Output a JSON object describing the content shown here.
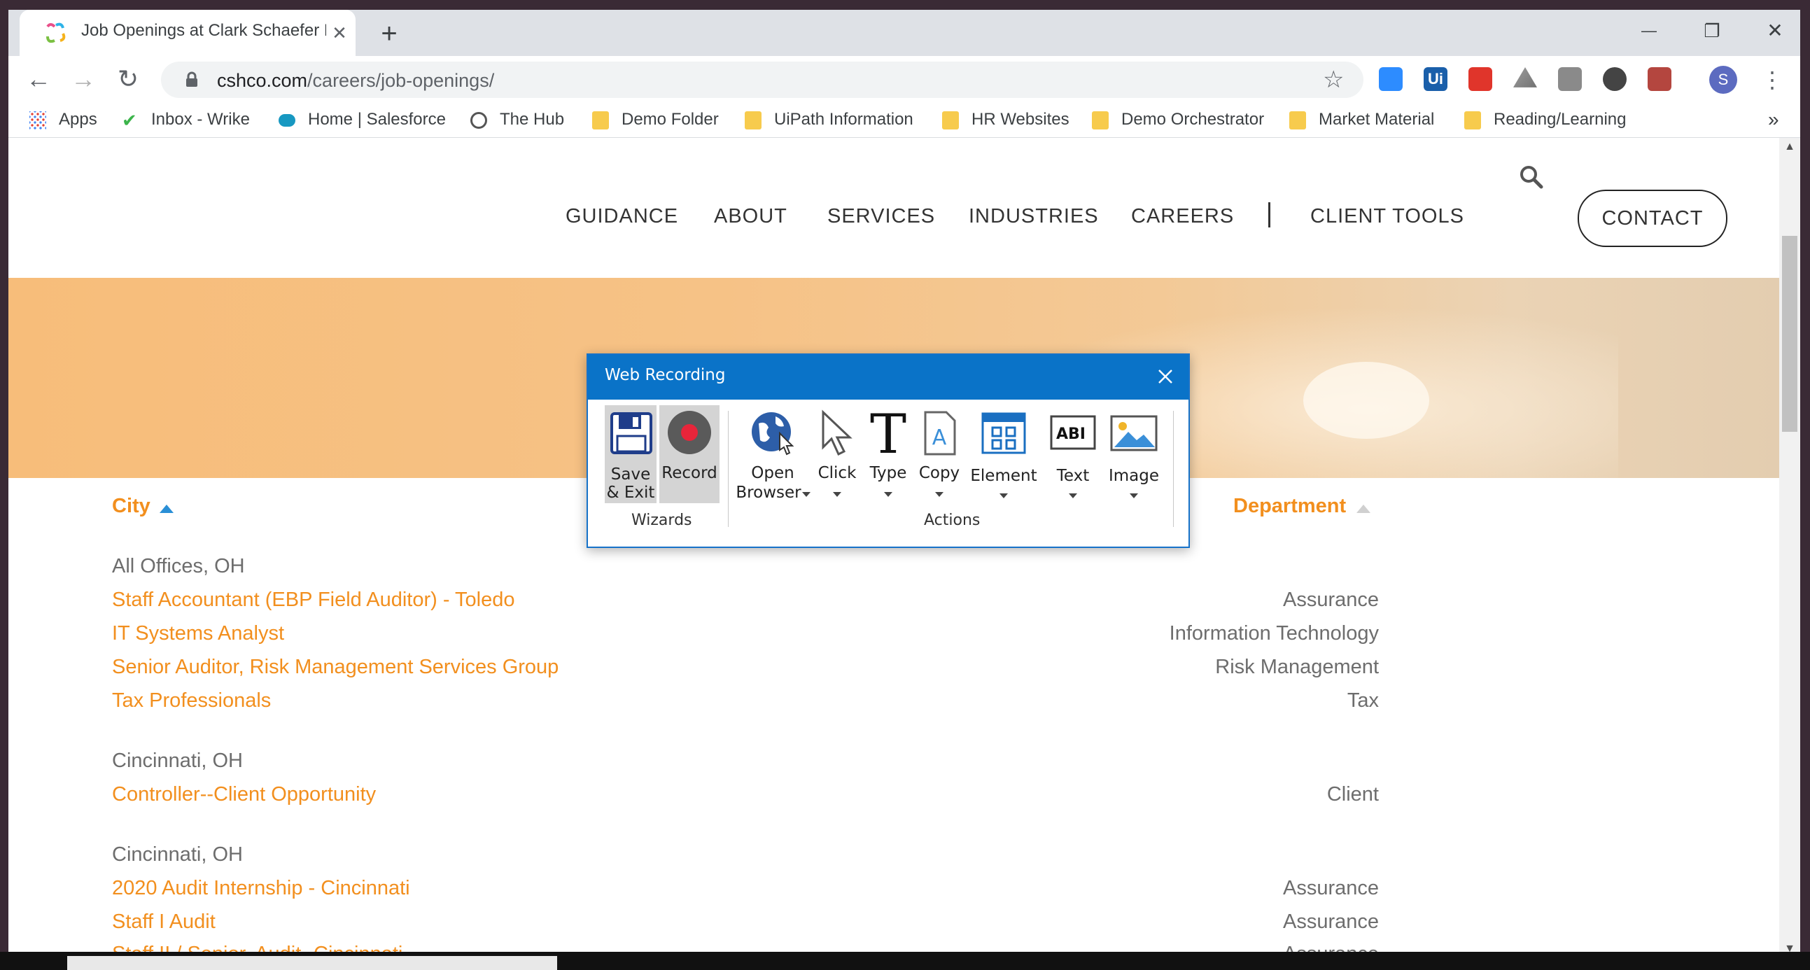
{
  "browser": {
    "tab_title": "Job Openings at Clark Schaefer H",
    "tab_close": "✕",
    "new_tab": "+",
    "window_controls": {
      "minimize": "—",
      "restore": "❐",
      "close": "✕"
    },
    "url_host": "cshco.com",
    "url_path": "/careers/job-openings/",
    "profile_initial": "S",
    "back": "←",
    "forward": "→",
    "reload": "↻",
    "star": "☆",
    "menu": "⋮",
    "extensions": [
      "zoom-icon",
      "uipath-icon",
      "bookmark-red-icon",
      "drive-icon",
      "reading-icon",
      "circle-icon",
      "pdf-icon"
    ]
  },
  "bookmarks": {
    "items": [
      {
        "label": "Apps",
        "icon": "apps-grid-icon"
      },
      {
        "label": "Inbox - Wrike",
        "icon": "wrike-check-icon"
      },
      {
        "label": "Home | Salesforce",
        "icon": "salesforce-cloud-icon"
      },
      {
        "label": "The Hub",
        "icon": "globe-icon"
      },
      {
        "label": "Demo Folder",
        "icon": "folder-icon"
      },
      {
        "label": "UiPath Information",
        "icon": "folder-icon"
      },
      {
        "label": "HR Websites",
        "icon": "folder-icon"
      },
      {
        "label": "Demo Orchestrator",
        "icon": "folder-icon"
      },
      {
        "label": "Market Material",
        "icon": "folder-icon"
      },
      {
        "label": "Reading/Learning",
        "icon": "folder-icon"
      }
    ],
    "more": "»"
  },
  "site": {
    "nav": [
      "GUIDANCE",
      "ABOUT",
      "SERVICES",
      "INDUSTRIES",
      "CAREERS",
      "CLIENT TOOLS"
    ],
    "contact": "CONTACT"
  },
  "jobs_table": {
    "col_city": "City",
    "col_department": "Department",
    "groups": [
      {
        "city": "All Offices, OH",
        "jobs": [
          {
            "title": "Staff Accountant (EBP Field Auditor) - Toledo",
            "dept": "Assurance"
          },
          {
            "title": "IT Systems Analyst",
            "dept": "Information Technology"
          },
          {
            "title": "Senior Auditor, Risk Management Services Group",
            "dept": "Risk Management"
          },
          {
            "title": "Tax Professionals",
            "dept": "Tax"
          }
        ]
      },
      {
        "city": "Cincinnati, OH",
        "jobs": [
          {
            "title": "Controller--Client Opportunity",
            "dept": "Client"
          }
        ]
      },
      {
        "city": "Cincinnati, OH",
        "jobs": [
          {
            "title": "2020 Audit Internship - Cincinnati",
            "dept": "Assurance"
          },
          {
            "title": "Staff I Audit",
            "dept": "Assurance"
          },
          {
            "title": "Staff II / Senior, Audit- Cincinnati",
            "dept": "Assurance"
          }
        ]
      }
    ]
  },
  "recorder": {
    "title": "Web Recording",
    "wizards_group": "Wizards",
    "actions_group": "Actions",
    "save_exit": [
      "Save",
      "& Exit"
    ],
    "record": "Record",
    "open_browser": [
      "Open",
      "Browser"
    ],
    "click": "Click",
    "type": "Type",
    "copy": "Copy",
    "element": "Element",
    "text": "Text",
    "image": "Image",
    "colors": {
      "titlebar": "#0a73c8",
      "record_dot": "#e8253a",
      "accent": "#f28f1e"
    }
  }
}
